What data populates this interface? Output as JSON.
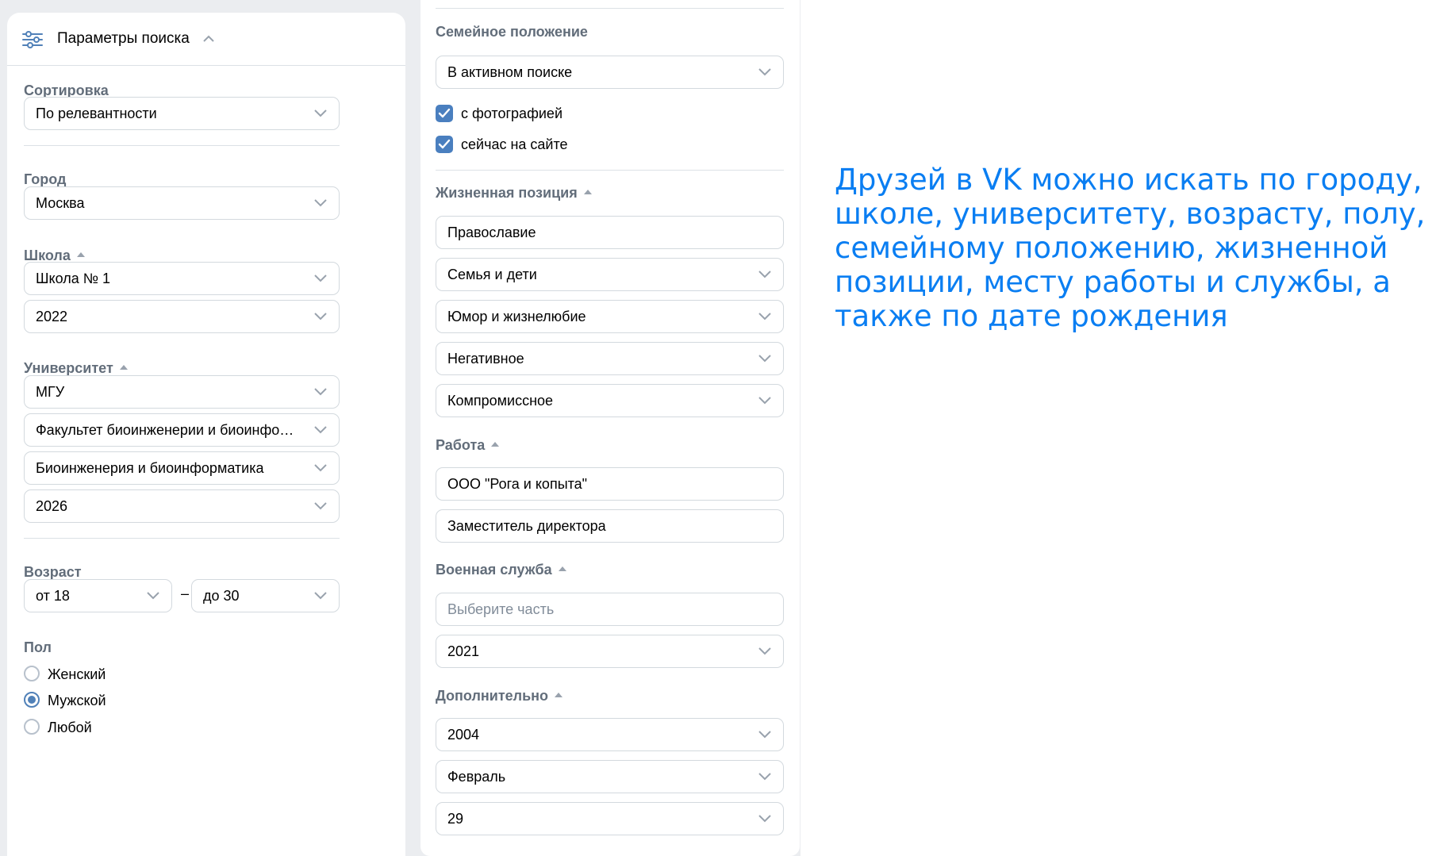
{
  "left_panel": {
    "header_title": "Параметры поиска",
    "sort": {
      "label": "Сортировка",
      "value": "По релевантности"
    },
    "city": {
      "label": "Город",
      "value": "Москва"
    },
    "school": {
      "label": "Школа",
      "name": "Школа № 1",
      "year": "2022"
    },
    "university": {
      "label": "Университет",
      "name": "МГУ",
      "faculty": "Факультет биоинженерии и биоинформатики",
      "chair": "Биоинженерия и биоинформатика",
      "year": "2026"
    },
    "age": {
      "label": "Возраст",
      "from": "от 18",
      "to": "до 30",
      "dash": "–"
    },
    "gender": {
      "label": "Пол",
      "options": [
        "Женский",
        "Мужской",
        "Любой"
      ],
      "selected": "Мужской"
    }
  },
  "middle_panel": {
    "marital": {
      "label": "Семейное положение",
      "value": "В активном поиске"
    },
    "checkboxes": [
      {
        "label": "с фотографией",
        "checked": true
      },
      {
        "label": "сейчас на сайте",
        "checked": true
      }
    ],
    "life_position": {
      "label": "Жизненная позиция",
      "values": [
        "Православие",
        "Семья и дети",
        "Юмор и жизнелюбие",
        "Негативное",
        "Компромиссное"
      ]
    },
    "work": {
      "label": "Работа",
      "company": "ООО \"Рога и копыта\"",
      "position": "Заместитель директора"
    },
    "military": {
      "label": "Военная служба",
      "unit_placeholder": "Выберите часть",
      "year": "2021"
    },
    "additional": {
      "label": "Дополнительно",
      "year": "2004",
      "month": "Февраль",
      "day": "29"
    }
  },
  "caption": "Друзей в VK можно искать по городу, школе, университету, возрасту, полу, семейному положению, жизненной позиции, месту работы и службы, а также по дате рождения",
  "colors": {
    "accent": "#0a7ef2",
    "checkbox": "#4a7fbf",
    "label": "#626d7a",
    "background": "#ebedf0"
  },
  "icons": [
    "filter-icon",
    "chevron-up-icon",
    "chevron-down-icon",
    "checkmark-icon"
  ]
}
